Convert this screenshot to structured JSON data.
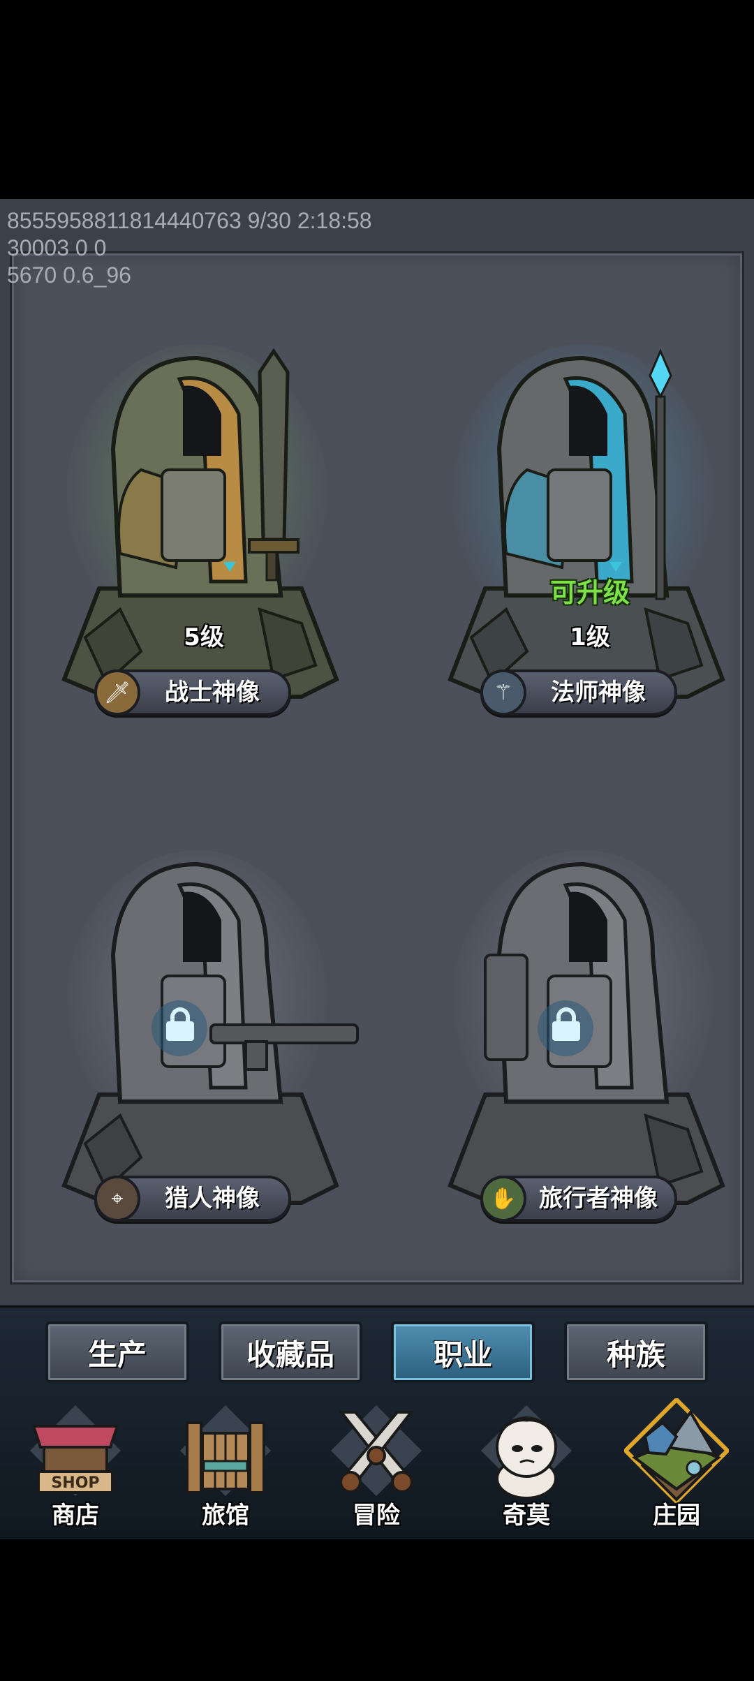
{
  "debug": {
    "line1": "8555958811814440763 9/30 2:18:58",
    "line2": "30003 0 0",
    "line3": "5670 0.6_96"
  },
  "statues": [
    {
      "name": "战士神像",
      "level": "5级",
      "status": "unlocked",
      "accent": "#d7a24b",
      "glow": "#8ccf6a",
      "icon": "sword-icon"
    },
    {
      "name": "法师神像",
      "level": "1级",
      "status": "upgradable",
      "upgrade_label": "可升级",
      "accent": "#3fb8d8",
      "glow": "#5ad0f0",
      "icon": "staff-icon"
    },
    {
      "name": "猎人神像",
      "status": "locked",
      "icon": "crosshair-icon"
    },
    {
      "name": "旅行者神像",
      "status": "locked",
      "icon": "boot-icon"
    }
  ],
  "tabs": [
    {
      "label": "生产",
      "active": false
    },
    {
      "label": "收藏品",
      "active": false
    },
    {
      "label": "职业",
      "active": true
    },
    {
      "label": "种族",
      "active": false
    }
  ],
  "nav": [
    {
      "label": "商店",
      "icon": "shop-icon",
      "sign": "SHOP"
    },
    {
      "label": "旅馆",
      "icon": "inn-gate-icon"
    },
    {
      "label": "冒险",
      "icon": "crossed-swords-icon"
    },
    {
      "label": "奇莫",
      "icon": "chimo-character-icon"
    },
    {
      "label": "庄园",
      "icon": "manor-island-icon"
    }
  ]
}
